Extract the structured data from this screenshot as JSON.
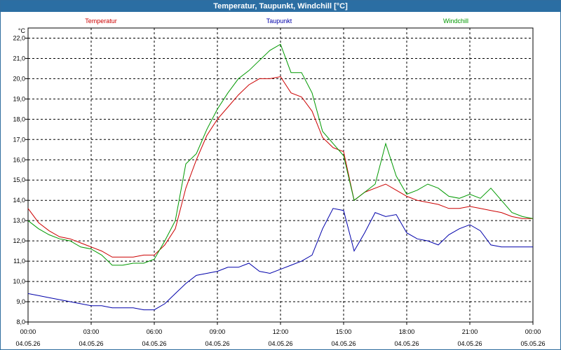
{
  "title": "Temperatur, Taupunkt, Windchill [°C]",
  "chart_data": {
    "type": "line",
    "ylabel": "°C",
    "ylim": [
      8.0,
      22.5
    ],
    "y_ticks": [
      "22,0",
      "21,0",
      "20,0",
      "19,0",
      "18,0",
      "17,0",
      "16,0",
      "15,0",
      "14,0",
      "13,0",
      "12,0",
      "11,0",
      "10,0",
      "9,0",
      "8,0"
    ],
    "x_ticks": [
      {
        "time": "00:00",
        "date": "04.05.26"
      },
      {
        "time": "03:00",
        "date": "04.05.26"
      },
      {
        "time": "06:00",
        "date": "04.05.26"
      },
      {
        "time": "09:00",
        "date": "04.05.26"
      },
      {
        "time": "12:00",
        "date": "04.05.26"
      },
      {
        "time": "15:00",
        "date": "04.05.26"
      },
      {
        "time": "18:00",
        "date": "04.05.26"
      },
      {
        "time": "21:00",
        "date": "04.05.26"
      },
      {
        "time": "00:00",
        "date": "05.05.26"
      }
    ],
    "x_range_hours": [
      0,
      24
    ],
    "grid": true,
    "legend_placement": "top",
    "series": [
      {
        "name": "Temperatur",
        "color": "#cc0000",
        "x": [
          0,
          0.5,
          1,
          1.5,
          2,
          2.5,
          3,
          3.5,
          4,
          4.5,
          5,
          5.5,
          6,
          6.5,
          7,
          7.5,
          8,
          8.5,
          9,
          9.5,
          10,
          10.5,
          11,
          11.5,
          12,
          12.5,
          13,
          13.5,
          14,
          14.5,
          15,
          15.5,
          16,
          16.5,
          17,
          17.5,
          18,
          18.5,
          19,
          19.5,
          20,
          20.5,
          21,
          21.5,
          22,
          22.5,
          23,
          23.5,
          24
        ],
        "y": [
          13.6,
          12.9,
          12.5,
          12.2,
          12.1,
          11.9,
          11.7,
          11.5,
          11.2,
          11.2,
          11.2,
          11.3,
          11.3,
          11.8,
          12.6,
          14.6,
          16.0,
          17.2,
          18.0,
          18.6,
          19.2,
          19.7,
          20.0,
          20.0,
          20.1,
          19.3,
          19.1,
          18.4,
          17.1,
          16.6,
          16.4,
          14.0,
          14.4,
          14.6,
          14.8,
          14.5,
          14.2,
          14.0,
          13.9,
          13.8,
          13.6,
          13.6,
          13.7,
          13.6,
          13.5,
          13.4,
          13.2,
          13.1,
          13.1
        ]
      },
      {
        "name": "Taupunkt",
        "color": "#0000aa",
        "x": [
          0,
          0.5,
          1,
          1.5,
          2,
          2.5,
          3,
          3.5,
          4,
          4.5,
          5,
          5.5,
          6,
          6.5,
          7,
          7.5,
          8,
          8.5,
          9,
          9.5,
          10,
          10.5,
          11,
          11.5,
          12,
          12.5,
          13,
          13.5,
          14,
          14.5,
          15,
          15.5,
          16,
          16.5,
          17,
          17.5,
          18,
          18.5,
          19,
          19.5,
          20,
          20.5,
          21,
          21.5,
          22,
          22.5,
          23,
          23.5,
          24
        ],
        "y": [
          9.4,
          9.3,
          9.2,
          9.1,
          9.0,
          8.9,
          8.8,
          8.8,
          8.7,
          8.7,
          8.7,
          8.6,
          8.6,
          8.9,
          9.4,
          9.9,
          10.3,
          10.4,
          10.5,
          10.7,
          10.7,
          10.9,
          10.5,
          10.4,
          10.6,
          10.8,
          11.0,
          11.3,
          12.6,
          13.6,
          13.5,
          11.5,
          12.4,
          13.4,
          13.2,
          13.3,
          12.4,
          12.1,
          12.0,
          11.8,
          12.3,
          12.6,
          12.8,
          12.5,
          11.8,
          11.7,
          11.7,
          11.7,
          11.7
        ]
      },
      {
        "name": "Windchill",
        "color": "#009900",
        "x": [
          0,
          0.5,
          1,
          1.5,
          2,
          2.5,
          3,
          3.5,
          4,
          4.5,
          5,
          5.5,
          6,
          6.5,
          7,
          7.5,
          8,
          8.5,
          9,
          9.5,
          10,
          10.5,
          11,
          11.5,
          12,
          12.5,
          13,
          13.5,
          14,
          14.5,
          15,
          15.5,
          16,
          16.5,
          17,
          17.5,
          18,
          18.5,
          19,
          19.5,
          20,
          20.5,
          21,
          21.5,
          22,
          22.5,
          23,
          23.5,
          24
        ],
        "y": [
          13.0,
          12.6,
          12.3,
          12.1,
          12.0,
          11.7,
          11.6,
          11.3,
          10.8,
          10.8,
          10.9,
          10.9,
          11.1,
          12.0,
          13.0,
          15.8,
          16.3,
          17.5,
          18.5,
          19.3,
          20.0,
          20.4,
          20.9,
          21.4,
          21.7,
          20.3,
          20.3,
          19.3,
          17.4,
          16.8,
          16.2,
          14.0,
          14.4,
          14.8,
          16.8,
          15.2,
          14.3,
          14.5,
          14.8,
          14.6,
          14.2,
          14.1,
          14.3,
          14.1,
          14.6,
          14.0,
          13.4,
          13.2,
          13.1
        ]
      }
    ]
  }
}
